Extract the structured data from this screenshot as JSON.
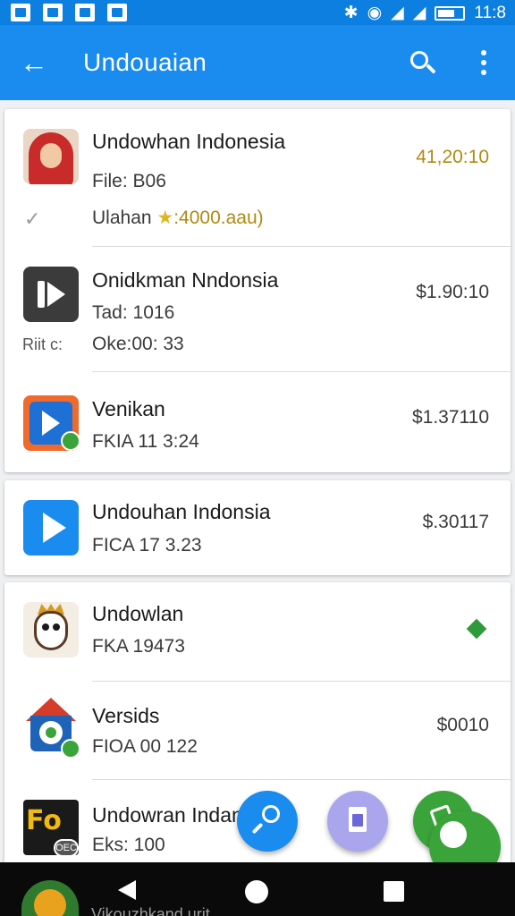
{
  "status_bar": {
    "time": "11:8",
    "icons": [
      "photo-icon",
      "play-store-icon",
      "p-icon",
      "shop-icon",
      "bluetooth-icon",
      "wifi-icon",
      "signal-icon",
      "signal-icon",
      "battery-icon"
    ]
  },
  "app_bar": {
    "title": "Undouaian",
    "icons": [
      "back-arrow-icon",
      "search-icon",
      "more-vert-icon"
    ]
  },
  "cards": [
    {
      "items": [
        {
          "icon": "hijab-portrait-icon",
          "title": "Undowhan Indonesia",
          "line2": "File: B06",
          "line3_prefix": "Ulahan ",
          "line3_star": "★",
          "line3_rating": ":4000.aau)",
          "price": "41,20:10",
          "price_color": "#b08a12",
          "left_mark": "✓"
        },
        {
          "icon": "dark-play-icon",
          "title": "Onidkman Nndonsia",
          "line2": "Tad: 1016",
          "line3": "Oke:00: 33",
          "price": "$1.90:10",
          "left_label": "Riit c:"
        },
        {
          "icon": "orange-play-icon",
          "title": "Venikan",
          "line2": "FKIA 11 3:24",
          "price": "$1.37110"
        }
      ]
    },
    {
      "items": [
        {
          "icon": "blue-play-icon",
          "title": "Undouhan Indonsia",
          "line2": "FICA 17 3.23",
          "price": "$.30117"
        }
      ]
    },
    {
      "items": [
        {
          "icon": "mask-character-icon",
          "title": "Undowlan",
          "line2": "FKA 19473",
          "indicator": "green-diamond-icon"
        },
        {
          "icon": "house-app-icon",
          "title": "Versids",
          "line2": "FIOA 00 122",
          "price": "$0010"
        },
        {
          "icon": "fo-app-icon",
          "title": "Undowran Indan",
          "line2": "Eks: 100",
          "badge_text": "OEC"
        }
      ]
    }
  ],
  "fabs": [
    "search-fab",
    "document-fab",
    "edit-fab",
    "primary-fab"
  ],
  "nav_bar": {
    "buttons": [
      "nav-back",
      "nav-home",
      "nav-recents"
    ]
  },
  "peek": {
    "text": "Vikouzhkand urit"
  },
  "colors": {
    "app_bar": "#1a8cf0",
    "status_bar": "#0d7fe0",
    "accent_green": "#3aa43a",
    "fab_purple": "#a9a6ee"
  }
}
